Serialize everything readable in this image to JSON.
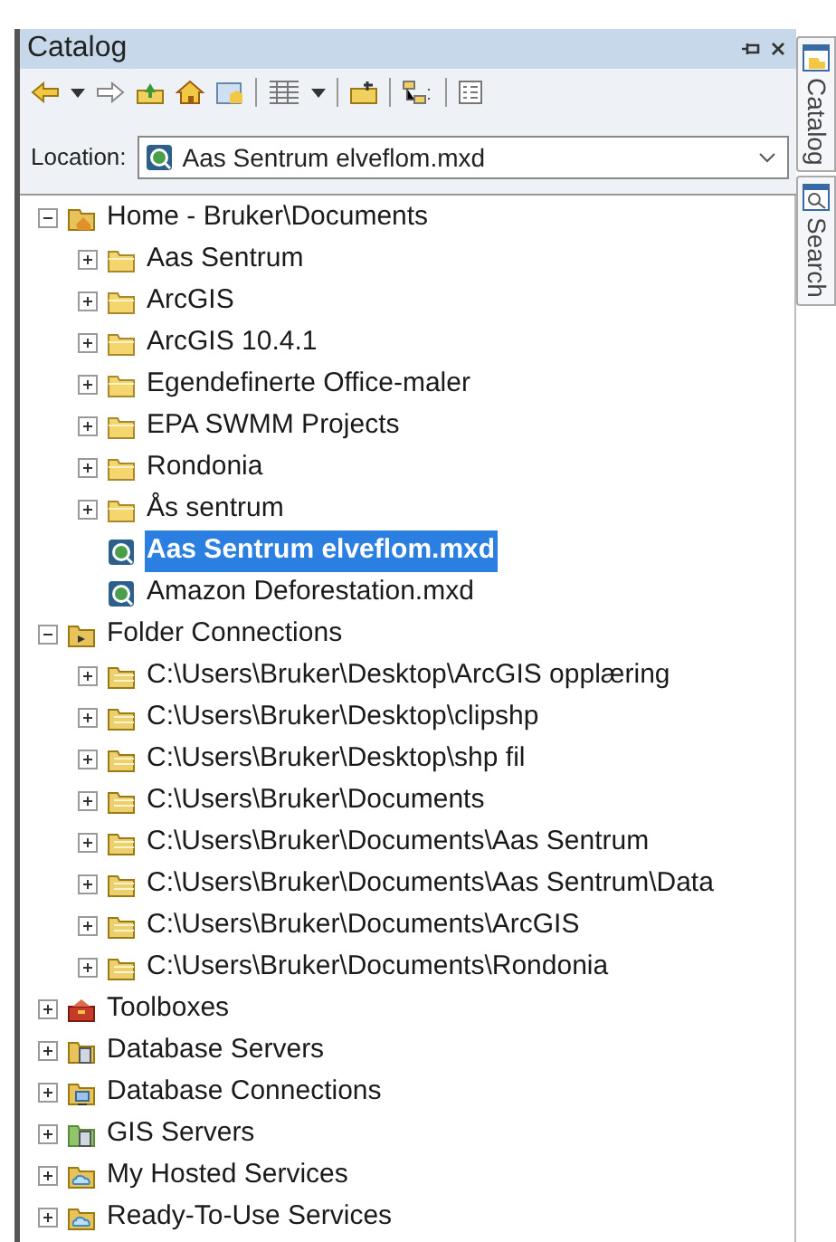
{
  "window": {
    "title": "Catalog"
  },
  "location": {
    "label": "Location:",
    "value": "Aas Sentrum elveflom.mxd"
  },
  "tree": [
    {
      "label": "Home - Bruker\\Documents",
      "kind": "home",
      "expanded": true,
      "selected": false,
      "children": [
        {
          "label": "Aas Sentrum",
          "kind": "folder",
          "expanded": false,
          "selected": false
        },
        {
          "label": "ArcGIS",
          "kind": "folder",
          "expanded": false,
          "selected": false
        },
        {
          "label": "ArcGIS 10.4.1",
          "kind": "folder",
          "expanded": false,
          "selected": false
        },
        {
          "label": "Egendefinerte Office-maler",
          "kind": "folder",
          "expanded": false,
          "selected": false
        },
        {
          "label": "EPA SWMM Projects",
          "kind": "folder",
          "expanded": false,
          "selected": false
        },
        {
          "label": "Rondonia",
          "kind": "folder",
          "expanded": false,
          "selected": false
        },
        {
          "label": "Ås sentrum",
          "kind": "folder",
          "expanded": false,
          "selected": false
        },
        {
          "label": "Aas Sentrum elveflom.mxd",
          "kind": "map",
          "selected": true
        },
        {
          "label": "Amazon Deforestation.mxd",
          "kind": "map",
          "selected": false
        }
      ]
    },
    {
      "label": "Folder Connections",
      "kind": "folder_connections",
      "expanded": true,
      "selected": false,
      "children": [
        {
          "label": "C:\\Users\\Bruker\\Desktop\\ArcGIS opplæring",
          "kind": "connection",
          "expanded": false,
          "selected": false
        },
        {
          "label": "C:\\Users\\Bruker\\Desktop\\clipshp",
          "kind": "connection",
          "expanded": false,
          "selected": false
        },
        {
          "label": "C:\\Users\\Bruker\\Desktop\\shp fil",
          "kind": "connection",
          "expanded": false,
          "selected": false
        },
        {
          "label": "C:\\Users\\Bruker\\Documents",
          "kind": "connection",
          "expanded": false,
          "selected": false
        },
        {
          "label": "C:\\Users\\Bruker\\Documents\\Aas Sentrum",
          "kind": "connection",
          "expanded": false,
          "selected": false
        },
        {
          "label": "C:\\Users\\Bruker\\Documents\\Aas Sentrum\\Data",
          "kind": "connection",
          "expanded": false,
          "selected": false
        },
        {
          "label": "C:\\Users\\Bruker\\Documents\\ArcGIS",
          "kind": "connection",
          "expanded": false,
          "selected": false
        },
        {
          "label": "C:\\Users\\Bruker\\Documents\\Rondonia",
          "kind": "connection",
          "expanded": false,
          "selected": false
        }
      ]
    },
    {
      "label": "Toolboxes",
      "kind": "toolbox",
      "expanded": false,
      "selected": false
    },
    {
      "label": "Database Servers",
      "kind": "database_servers",
      "expanded": false,
      "selected": false
    },
    {
      "label": "Database Connections",
      "kind": "database_connections",
      "expanded": false,
      "selected": false
    },
    {
      "label": "GIS Servers",
      "kind": "gis_servers",
      "expanded": false,
      "selected": false
    },
    {
      "label": "My Hosted Services",
      "kind": "hosted_services",
      "expanded": false,
      "selected": false
    },
    {
      "label": "Ready-To-Use Services",
      "kind": "hosted_services",
      "expanded": false,
      "selected": false
    }
  ],
  "side_tabs": [
    {
      "label": "Catalog",
      "kind": "catalog"
    },
    {
      "label": "Search",
      "kind": "search"
    }
  ]
}
